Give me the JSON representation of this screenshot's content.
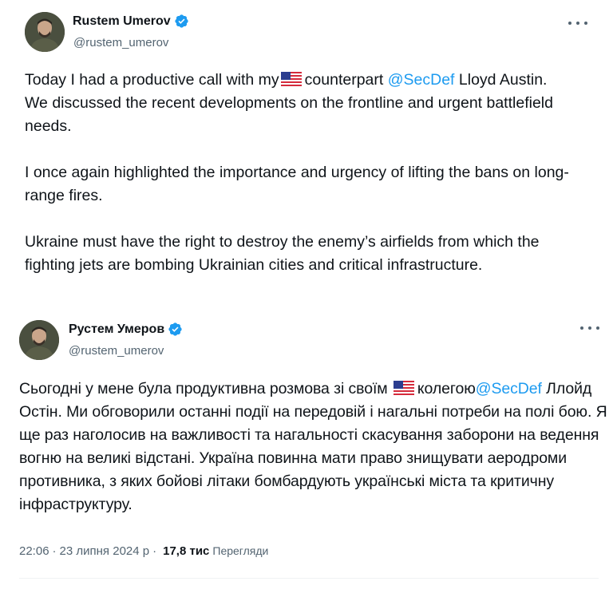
{
  "tweets": [
    {
      "author": {
        "name": "Rustem Umerov",
        "handle": "@rustem_umerov",
        "verified_icon": "verified-badge-icon"
      },
      "lines": [
        [
          "Today I had a productive call with my ",
          "FLAG",
          " counterpart ",
          "@SecDef",
          " Lloyd Austin."
        ],
        [
          "We discussed the recent developments on the frontline and urgent battlefield needs."
        ],
        [],
        [
          "I once again highlighted the importance and urgency of lifting the bans on long-range fires."
        ],
        [],
        [
          "Ukraine must have the right to destroy the enemy’s airfields from which the fighting jets are bombing Ukrainian cities and critical infrastructure."
        ]
      ],
      "text": {
        "p1_a": "Today I had a productive call with my",
        "p1_b": "counterpart",
        "p1_mention": "@SecDef",
        "p1_c": "Lloyd Austin.",
        "p2": "We discussed the recent developments on the frontline and urgent battlefield needs.",
        "p3": "I once again highlighted the importance and urgency of lifting the bans on long-range fires.",
        "p4": "Ukraine must have the right to destroy the enemy’s airfields from which the fighting jets are bombing Ukrainian cities and critical infrastructure."
      }
    },
    {
      "author": {
        "name": "Рустем Умеров",
        "handle": "@rustem_umerov",
        "verified_icon": "verified-badge-icon"
      },
      "text": {
        "a": "Сьогодні у мене була продуктивна розмова зі своїм",
        "b": "колегою",
        "mention": "@SecDef",
        "c": "Ллойд Остін. Ми обговорили останні події на передовій і нагальні потреби на полі бою. Я ще раз наголосив на важливості та нагальності скасування заборони на ведення вогню на великі відстані. Україна повинна мати право знищувати аеродроми противника, з яких бойові літаки бомбардують українські міста та критичну інфраструктуру."
      },
      "meta": {
        "time": "22:06",
        "separator": "·",
        "date": "23 липня 2024 р",
        "views_count": "17,8 тис",
        "views_label": "Перегляди"
      }
    }
  ],
  "colors": {
    "text": "#0f1419",
    "secondary": "#536471",
    "link": "#1d9bf0",
    "verified": "#1d9bf0"
  }
}
